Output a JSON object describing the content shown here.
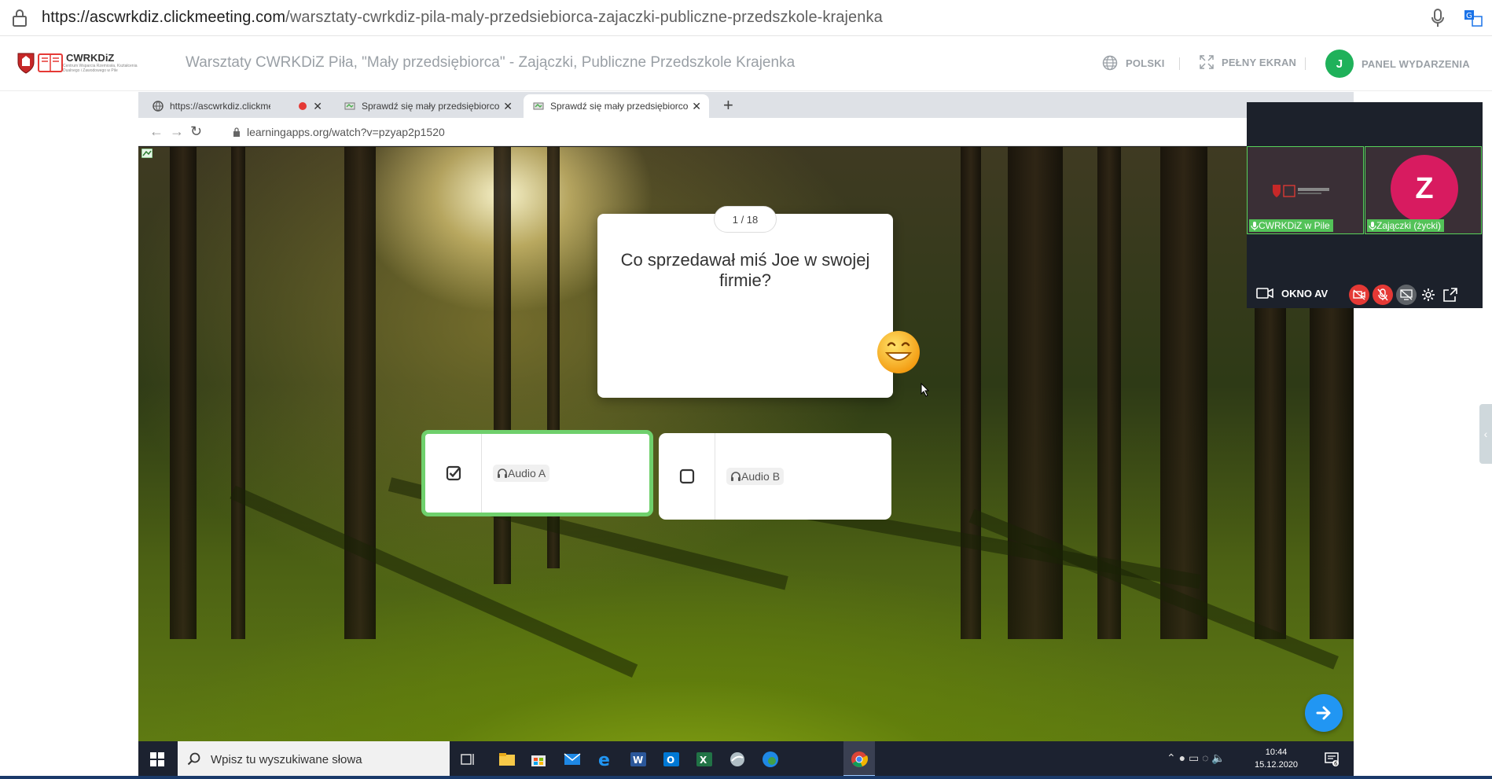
{
  "address_bar": {
    "url_domain": "https://ascwrkdiz.clickmeeting.com",
    "url_path": "/warsztaty-cwrkdiz-pila-maly-przedsiebiorca-zajaczki-publiczne-przedszkole-krajenka"
  },
  "header": {
    "logo_text": "CWRKDiZ",
    "logo_subtext": "Centrum Wsparcia Rzemiosła, Kształcenia Dualnego i Zawodowego w Pile",
    "title": "Warsztaty CWRKDiZ Piła, \"Mały przedsiębiorca\" - Zajączki, Publiczne Przedszkole Krajenka",
    "language_label": "POLSKI",
    "fullscreen_label": "PEŁNY EKRAN",
    "panel_label": "PANEL WYDARZENIA",
    "avatar_initial": "J",
    "accent_color": "#1fb15a"
  },
  "inner_browser": {
    "tabs": [
      {
        "label": "https://ascwrkdiz.clickmeetin"
      },
      {
        "label": "Sprawdź się mały przedsiębiorco"
      },
      {
        "label": "Sprawdź się mały przedsiębiorco"
      }
    ],
    "url": "learningapps.org/watch?v=pzyap2p1520"
  },
  "quiz": {
    "counter": "1 / 18",
    "question": "Co sprzedawał miś Joe w swojej firmie?",
    "answers": [
      {
        "label": "Audio A",
        "checked": true
      },
      {
        "label": "Audio B",
        "checked": false
      }
    ],
    "selected_border_color": "#6fd06c"
  },
  "taskbar": {
    "search_placeholder": "Wpisz tu wyszukiwane słowa",
    "time": "10:44",
    "date": "15.12.2020",
    "notification_count": "6"
  },
  "av_panel": {
    "participants": [
      {
        "name": "CWRKDiZ w Pile"
      },
      {
        "name": "Zajączki (życki)",
        "initial": "Z"
      }
    ],
    "label": "OKNO AV"
  }
}
